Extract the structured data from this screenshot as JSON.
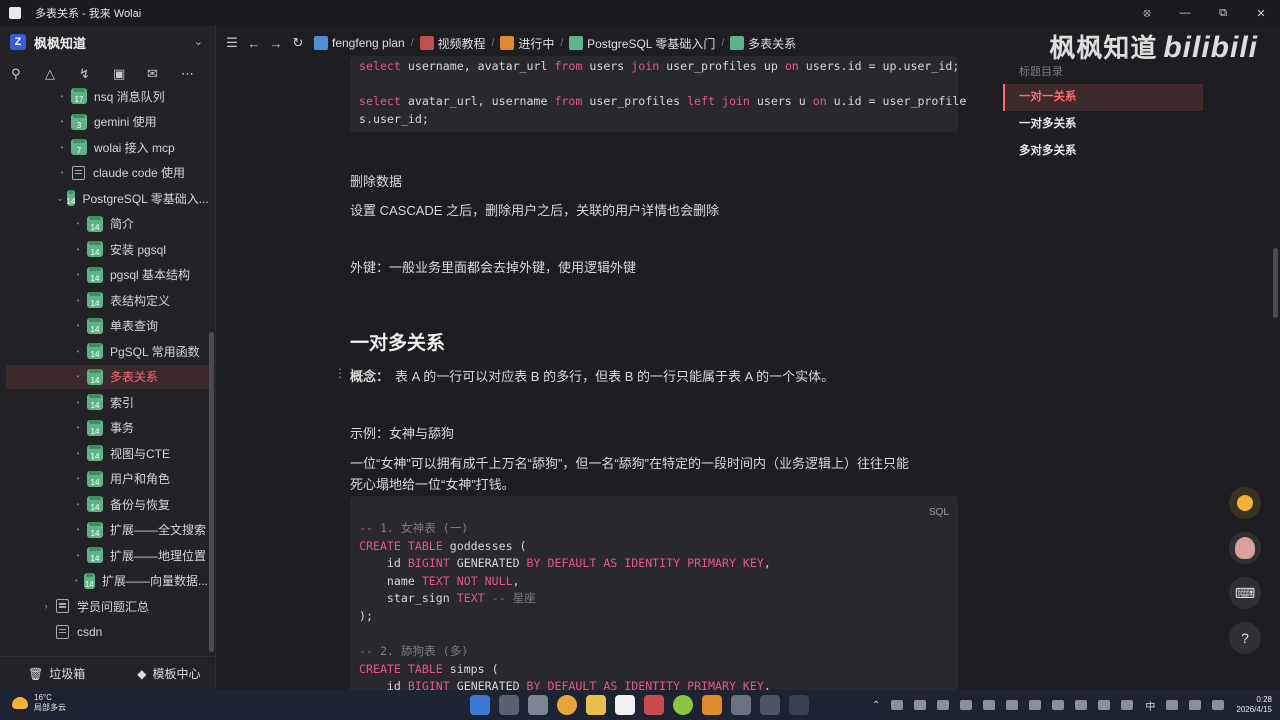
{
  "window": {
    "title": "多表关系 - 我来 Wolai",
    "controls": [
      "⦻",
      "—",
      "⧉",
      "✕"
    ]
  },
  "sidebar": {
    "workspace": "枫枫知道",
    "items": [
      {
        "label": "nsq 消息队列",
        "kind": "page",
        "num": "17",
        "indent": 1
      },
      {
        "label": "gemini 使用",
        "kind": "page",
        "num": "3",
        "indent": 1
      },
      {
        "label": "wolai 接入 mcp",
        "kind": "page",
        "num": "7",
        "indent": 1
      },
      {
        "label": "claude code 使用",
        "kind": "doc",
        "num": "",
        "indent": 1
      },
      {
        "label": "PostgreSQL 零基础入...",
        "kind": "page",
        "num": "14",
        "indent": 1,
        "expanded": true
      },
      {
        "label": "简介",
        "kind": "page",
        "num": "14",
        "indent": 2
      },
      {
        "label": "安装 pgsql",
        "kind": "page",
        "num": "14",
        "indent": 2
      },
      {
        "label": "pgsql 基本结构",
        "kind": "page",
        "num": "14",
        "indent": 2
      },
      {
        "label": "表结构定义",
        "kind": "page",
        "num": "14",
        "indent": 2
      },
      {
        "label": "单表查询",
        "kind": "page",
        "num": "14",
        "indent": 2
      },
      {
        "label": "PgSQL 常用函数",
        "kind": "page",
        "num": "14",
        "indent": 2
      },
      {
        "label": "多表关系",
        "kind": "page",
        "num": "14",
        "indent": 2,
        "active": true
      },
      {
        "label": "索引",
        "kind": "page",
        "num": "14",
        "indent": 2
      },
      {
        "label": "事务",
        "kind": "page",
        "num": "14",
        "indent": 2
      },
      {
        "label": "视图与CTE",
        "kind": "page",
        "num": "14",
        "indent": 2
      },
      {
        "label": "用户和角色",
        "kind": "page",
        "num": "14",
        "indent": 2
      },
      {
        "label": "备份与恢复",
        "kind": "page",
        "num": "14",
        "indent": 2
      },
      {
        "label": "扩展——全文搜索",
        "kind": "page",
        "num": "14",
        "indent": 2
      },
      {
        "label": "扩展——地理位置",
        "kind": "page",
        "num": "14",
        "indent": 2
      },
      {
        "label": "扩展——向量数据...",
        "kind": "page",
        "num": "14",
        "indent": 2
      },
      {
        "label": "学员问题汇总",
        "kind": "doc",
        "num": "",
        "indent": 0,
        "collapsed": true
      },
      {
        "label": "csdn",
        "kind": "doc",
        "num": "",
        "indent": -1
      }
    ],
    "trash": "垃圾箱",
    "templates": "模板中心"
  },
  "breadcrumb": [
    {
      "label": "fengfeng plan",
      "color": "#4f8fd6"
    },
    {
      "label": "视频教程",
      "color": "#c0504d"
    },
    {
      "label": "进行中",
      "color": "#e08a2c"
    },
    {
      "label": "PostgreSQL 零基础入门",
      "color": "#5fb38a"
    },
    {
      "label": "多表关系",
      "color": "#5fb38a"
    }
  ],
  "watermark": {
    "text": "枫枫知道",
    "logo": "bilibili"
  },
  "content": {
    "code1": {
      "line1": "select username, avatar_url from users join user_profiles up on users.id = up.user_id;",
      "line2": "select avatar_url, username from user_profiles left join users u on u.id = user_profile",
      "line3": "s.user_id;"
    },
    "p_delete_title": "删除数据",
    "p_cascade": "设置 CASCADE 之后，删除用户之后，关联的用户详情也会删除",
    "p_foreign": "外键：一般业务里面都会去掉外键，使用逻辑外键",
    "h_one_many": "一对多关系",
    "concept_label": "概念：",
    "concept_text": "表 A 的一行可以对应表 B 的多行，但表 B 的一行只能属于表 A 的一个实体。",
    "example_title": "示例：女神与舔狗",
    "example_line1": "一位“女神”可以拥有成千上万名“舔狗”，但一名“舔狗”在特定的一段时间内（业务逻辑上）往往只能",
    "example_line2": "死心塌地给一位“女神”打钱。",
    "code2_lang": "SQL"
  },
  "outline": {
    "title": "标题目录",
    "items": [
      "一对一关系",
      "一对多关系",
      "多对多关系"
    ]
  },
  "taskbar": {
    "temp": "16°C",
    "weather": "局部多云",
    "time": "0:28",
    "date": "2026/4/15",
    "ime": "中"
  },
  "colors": {
    "accent": "#ff6b6b",
    "keyword": "#e4558a",
    "page_icon": "#5fb38a"
  }
}
